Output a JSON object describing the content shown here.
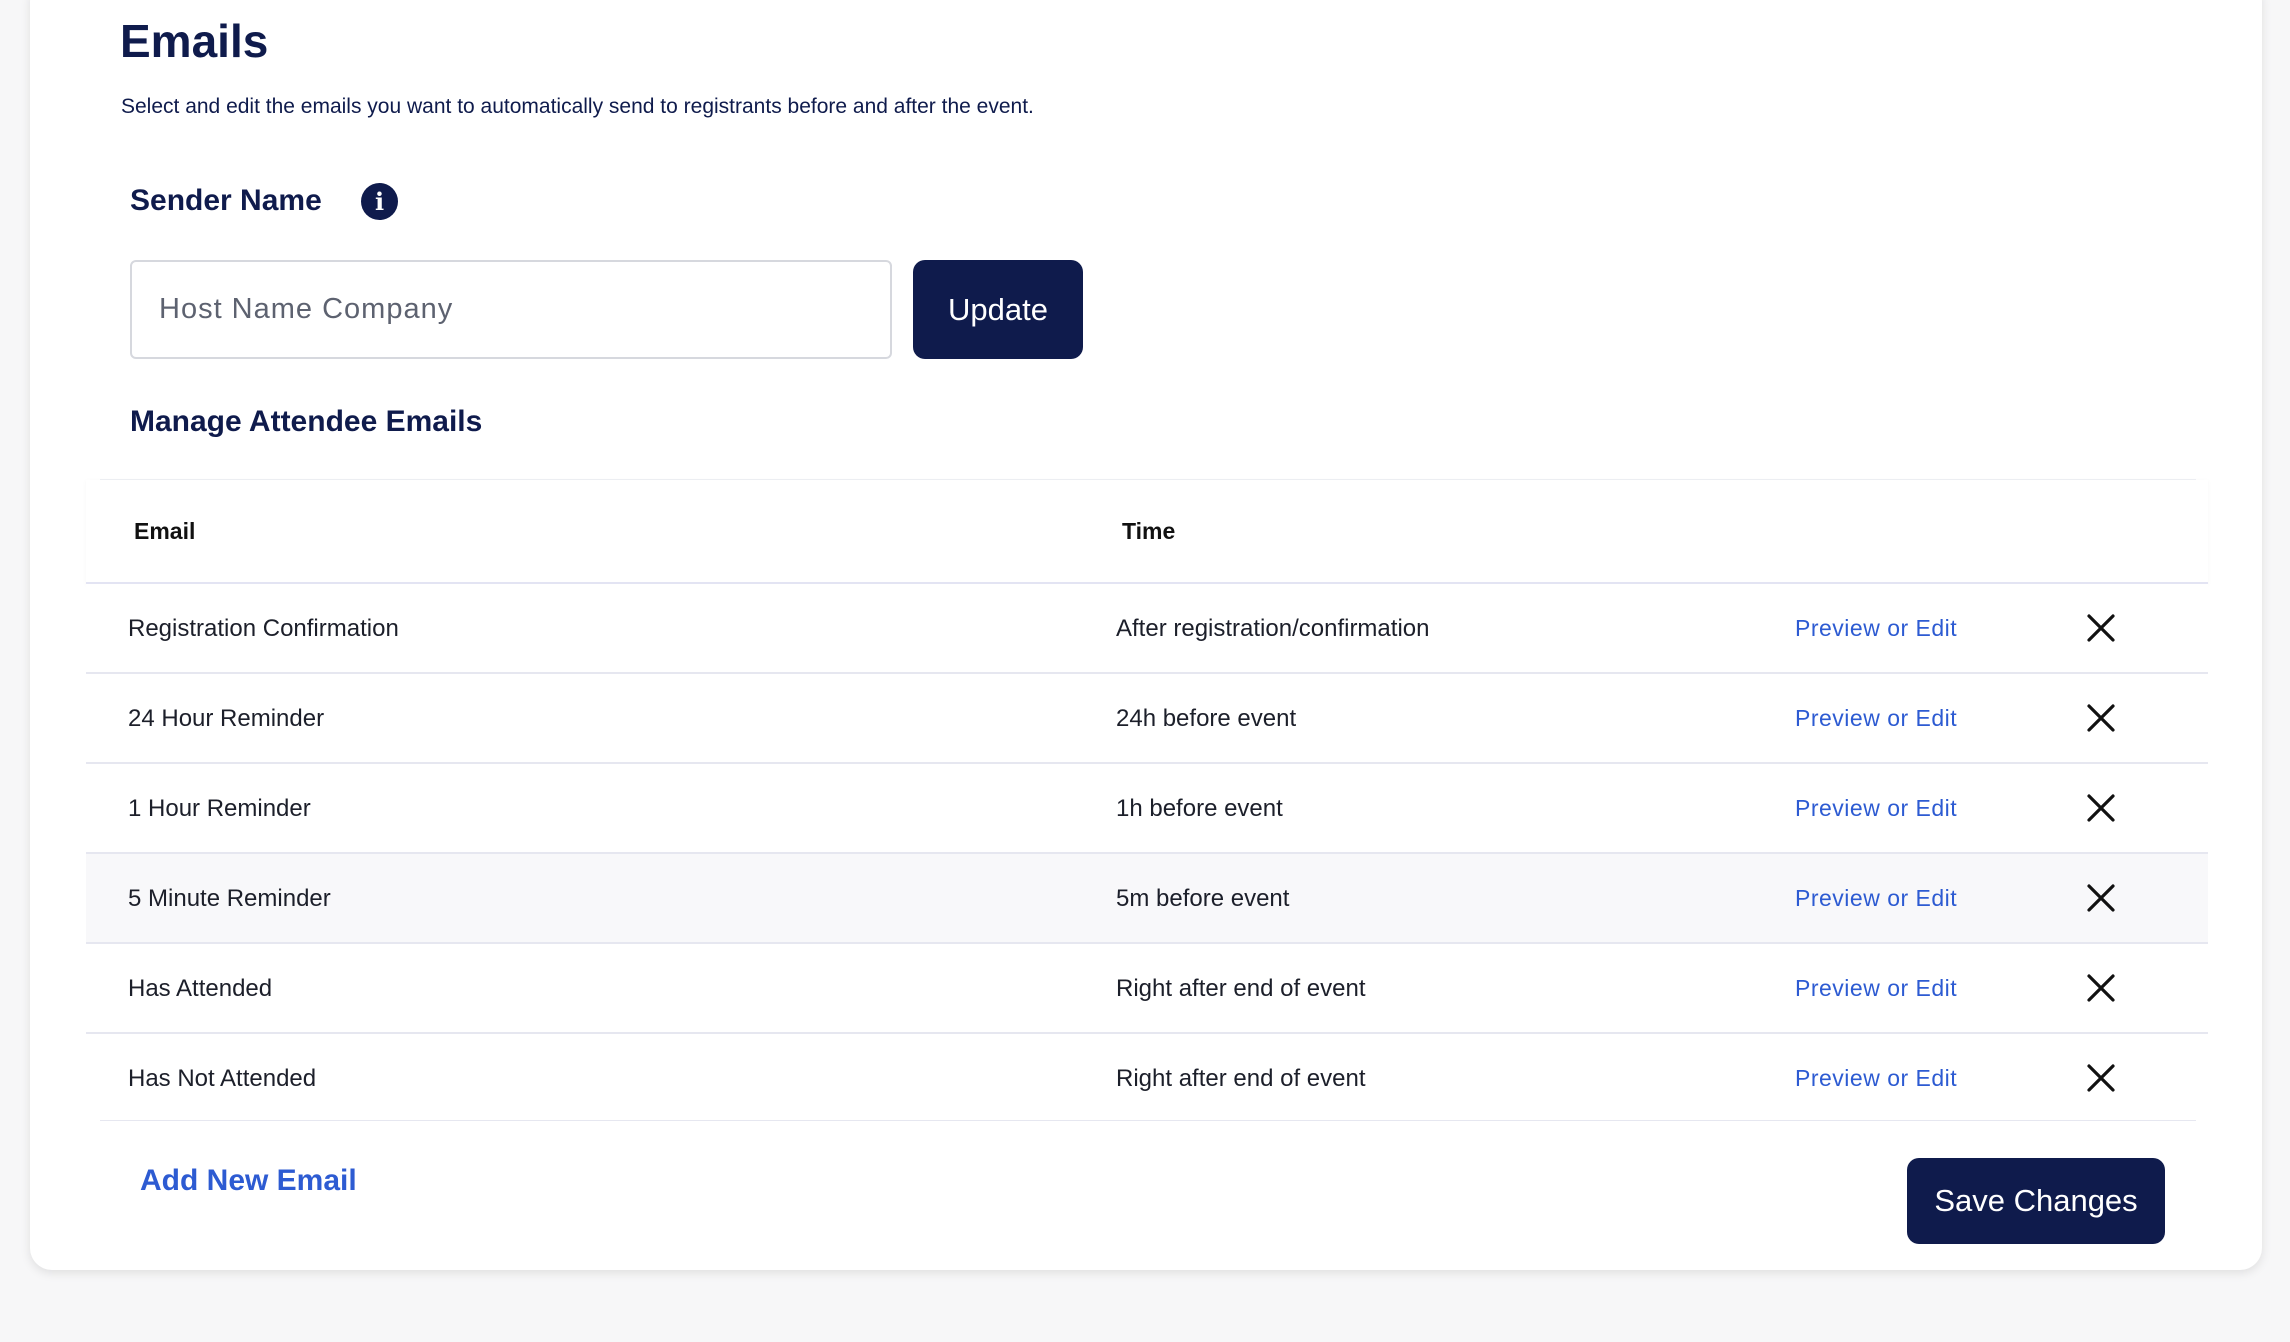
{
  "header": {
    "title": "Emails",
    "subtitle": "Select and edit the emails you want to automatically send to registrants before and after the event."
  },
  "sender": {
    "label": "Sender Name",
    "info_icon": "info-icon",
    "placeholder": "Host Name Company",
    "value": "",
    "update_label": "Update"
  },
  "manage": {
    "label": "Manage Attendee Emails"
  },
  "table": {
    "columns": [
      "Email",
      "Time"
    ],
    "rows": [
      {
        "email": "Registration Confirmation",
        "time": "After registration/confirmation",
        "action": "Preview or Edit"
      },
      {
        "email": "24 Hour Reminder",
        "time": "24h before event",
        "action": "Preview or Edit"
      },
      {
        "email": "1 Hour Reminder",
        "time": "1h before event",
        "action": "Preview or Edit"
      },
      {
        "email": "5 Minute Reminder",
        "time": "5m before event",
        "action": "Preview or Edit"
      },
      {
        "email": "Has Attended",
        "time": "Right after end of event",
        "action": "Preview or Edit"
      },
      {
        "email": "Has Not Attended",
        "time": "Right after end of event",
        "action": "Preview or Edit"
      }
    ],
    "remove_icon": "close-icon"
  },
  "footer": {
    "add_label": "Add New Email",
    "save_label": "Save Changes"
  },
  "colors": {
    "primary": "#0f1b4c",
    "link": "#2d5bd2",
    "background": "#f7f7f8",
    "card": "#ffffff"
  }
}
